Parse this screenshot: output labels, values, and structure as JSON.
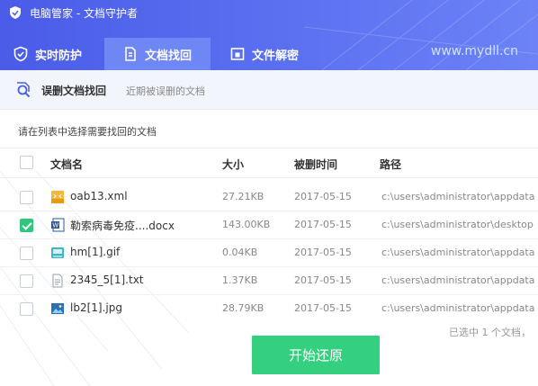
{
  "window": {
    "title": "电脑管家 - 文档守护者"
  },
  "tabs": [
    {
      "label": "实时防护",
      "icon": "shield-icon",
      "active": false
    },
    {
      "label": "文档找回",
      "icon": "document-restore-icon",
      "active": true
    },
    {
      "label": "文件解密",
      "icon": "unlock-icon",
      "active": false
    }
  ],
  "watermark": "www.mydll.cn",
  "section": {
    "title": "误删文档找回",
    "subtitle": "近期被误删的文档",
    "icon": "search-icon"
  },
  "instruction": "请在列表中选择需要找回的文档",
  "table": {
    "columns": [
      "文档名",
      "大小",
      "被删时间",
      "路径"
    ],
    "rows": [
      {
        "name": "oab13.xml",
        "size": "27.21KB",
        "date": "2017-05-15",
        "path": "c:\\users\\administrator\\appdata",
        "checked": false,
        "icon": "xml-file-icon"
      },
      {
        "name": "勒索病毒免疫....docx",
        "size": "143.00KB",
        "date": "2017-05-15",
        "path": "c:\\users\\administrator\\desktop",
        "checked": true,
        "icon": "word-file-icon"
      },
      {
        "name": "hm[1].gif",
        "size": "0.04KB",
        "date": "2017-05-15",
        "path": "c:\\users\\administrator\\appdata",
        "checked": false,
        "icon": "gif-file-icon"
      },
      {
        "name": "2345_5[1].txt",
        "size": "1.37KB",
        "date": "2017-05-15",
        "path": "c:\\users\\administrator\\appdata",
        "checked": false,
        "icon": "txt-file-icon"
      },
      {
        "name": "lb2[1].jpg",
        "size": "28.79KB",
        "date": "2017-05-15",
        "path": "c:\\users\\administrator\\appdata",
        "checked": false,
        "icon": "image-file-icon"
      }
    ]
  },
  "status": "已选中 1 个文档，",
  "restore_button": "开始还原",
  "colors": {
    "header": "#5368ee",
    "active_tab": "#6f86f5",
    "accent_green": "#35d07f"
  }
}
